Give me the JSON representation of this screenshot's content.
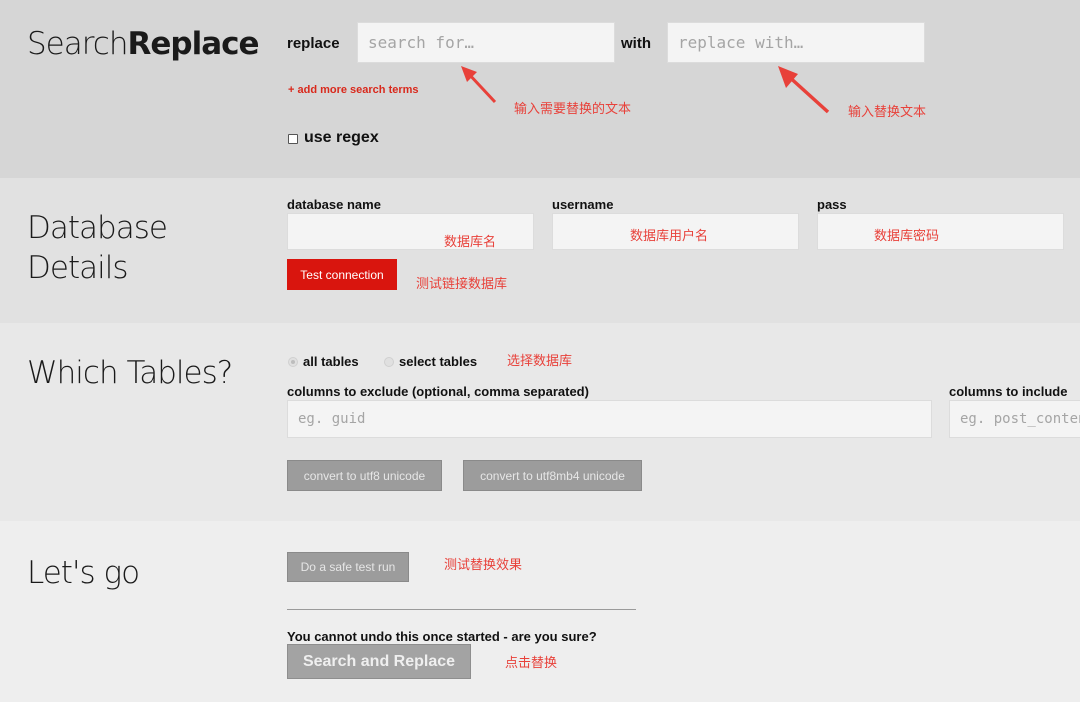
{
  "header": {
    "logo_light": "Search",
    "logo_bold": "Replace",
    "replace_label": "replace",
    "search_placeholder": "search for…",
    "with_label": "with",
    "replace_placeholder": "replace with…",
    "add_terms_link": "+ add more search terms",
    "use_regex_label": "use regex",
    "use_regex_checked": false
  },
  "database": {
    "heading_line1": "Database",
    "heading_line2": "Details",
    "fields": [
      {
        "label": "database name",
        "value": ""
      },
      {
        "label": "username",
        "value": ""
      },
      {
        "label": "pass",
        "value": ""
      }
    ],
    "test_button": "Test connection"
  },
  "tables": {
    "heading": "Which Tables?",
    "radio_all": "all tables",
    "radio_select": "select tables",
    "selected": "all tables",
    "exclude_label": "columns to exclude (optional, comma separated)",
    "exclude_placeholder": "eg. guid",
    "include_label": "columns to include",
    "include_placeholder": "eg. post_content",
    "utf8_button": "convert to utf8 unicode",
    "utf8mb4_button": "convert to utf8mb4 unicode"
  },
  "go": {
    "heading": "Let's go",
    "dry_run_button": "Do a safe test run",
    "warning": "You cannot undo this once started - are you sure?",
    "run_button": "Search and Replace"
  },
  "annotations": {
    "search_hint": "输入需要替换的文本",
    "replace_hint": "输入替换文本",
    "db_name_hint": "数据库名",
    "user_hint": "数据库用户名",
    "pass_hint": "数据库密码",
    "test_hint": "测试链接数据库",
    "tables_hint": "选择数据库",
    "dry_run_hint": "测试替换效果",
    "run_hint": "点击替换"
  },
  "colors": {
    "accent_red": "#d9150e",
    "annotation_red": "#e8413a"
  }
}
